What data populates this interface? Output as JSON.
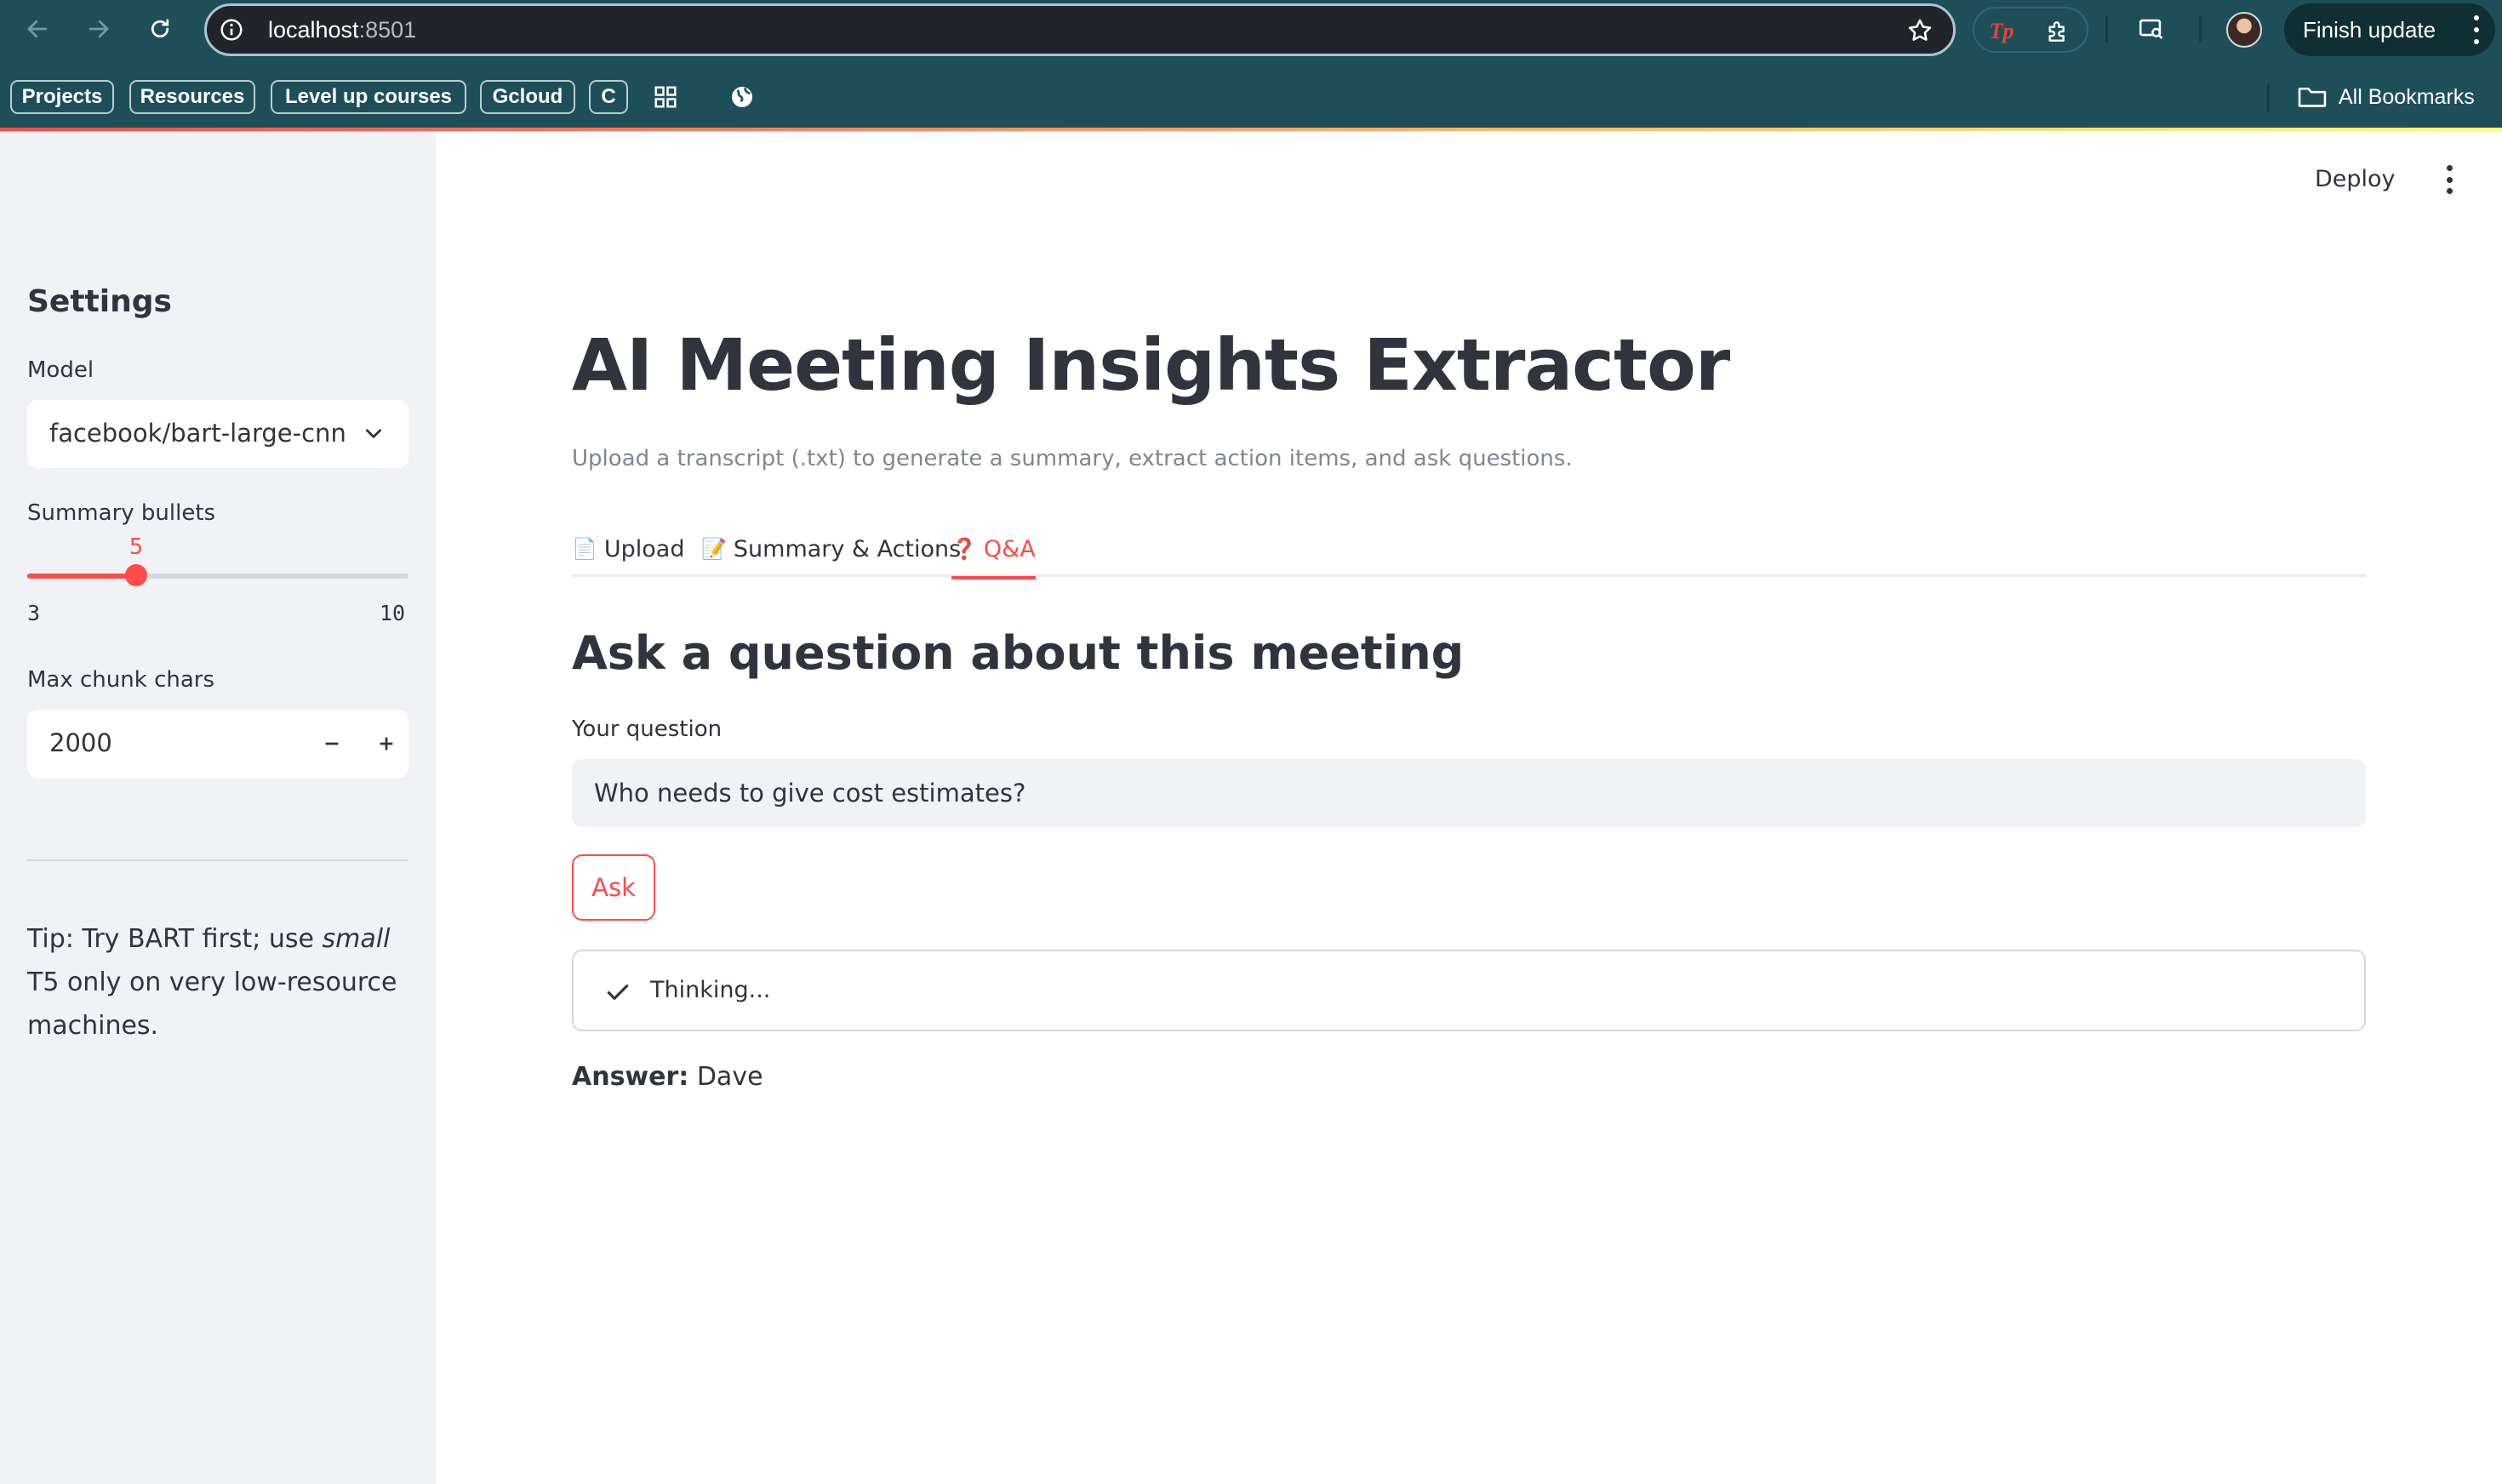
{
  "browser": {
    "url_host": "localhost",
    "url_port": ":8501",
    "finish_update_label": "Finish update",
    "bookmarks": [
      "Projects",
      "Resources",
      "Level up courses",
      "Gcloud",
      "C"
    ],
    "all_bookmarks_label": "All Bookmarks",
    "extension_label": "Tp",
    "colors": {
      "chrome_bg": "#1e4f59",
      "url_bar_bg": "#212429"
    }
  },
  "sidebar": {
    "header": "Settings",
    "model_label": "Model",
    "model_value": "facebook/bart-large-cnn",
    "summary_bullets_label": "Summary bullets",
    "summary_bullets": {
      "value": "5",
      "min": "3",
      "max": "10"
    },
    "max_chunk_label": "Max chunk chars",
    "max_chunk_value": "2000",
    "tip_prefix": "Tip: Try BART first; use ",
    "tip_em": "small",
    "tip_suffix": " T5 only on very low-resource machines."
  },
  "main": {
    "deploy_label": "Deploy",
    "title": "AI Meeting Insights Extractor",
    "caption": "Upload a transcript (.txt) to generate a summary, extract action items, and ask questions.",
    "tabs": [
      {
        "emoji": "📄",
        "label": "Upload"
      },
      {
        "emoji": "📝",
        "label": "Summary & Actions"
      },
      {
        "emoji": "❓",
        "label": "Q&A"
      }
    ],
    "qa": {
      "heading": "Ask a question about this meeting",
      "question_label": "Your question",
      "question_value": "Who needs to give cost estimates?",
      "ask_label": "Ask",
      "status_text": "Thinking...",
      "answer_label": "Answer:",
      "answer_value": " Dave"
    }
  },
  "theme": {
    "primary": "#ff4b4b",
    "sidebar_bg": "#f0f2f6",
    "text": "#31333f"
  }
}
